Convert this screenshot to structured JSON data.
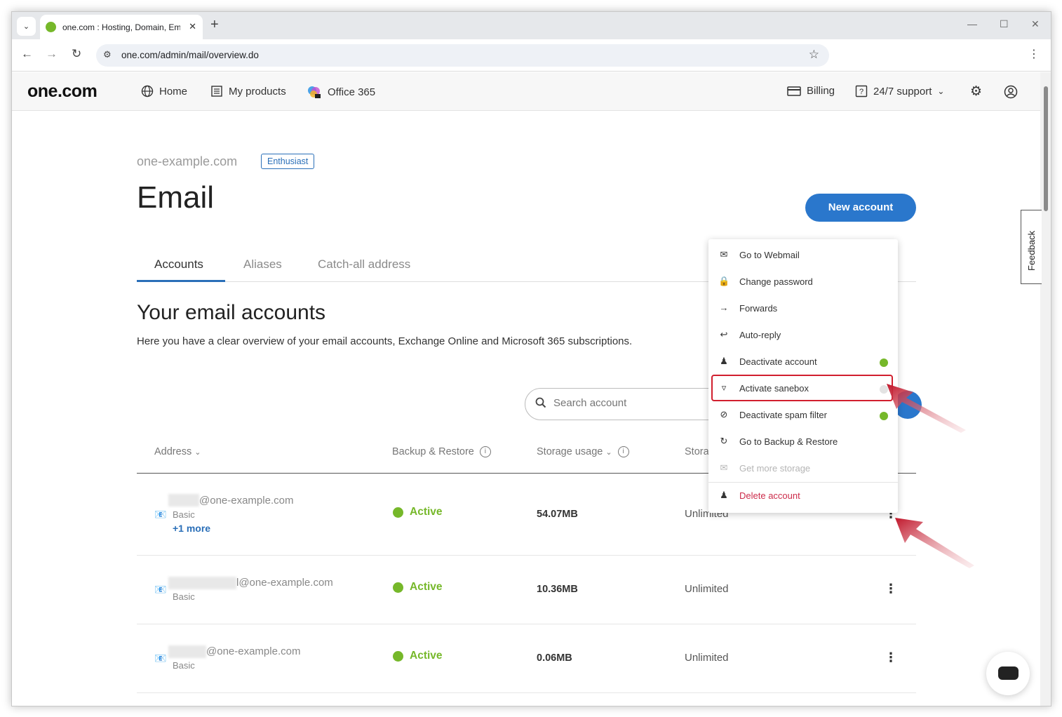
{
  "browser": {
    "tab_title": "one.com : Hosting, Domain, Em",
    "url": "one.com/admin/mail/overview.do"
  },
  "header": {
    "logo": "one.com",
    "nav": [
      {
        "label": "Home",
        "icon": "globe-icon"
      },
      {
        "label": "My products",
        "icon": "list-icon"
      },
      {
        "label": "Office 365",
        "icon": "office-icon"
      }
    ],
    "billing": "Billing",
    "support": "24/7 support"
  },
  "feedback_label": "Feedback",
  "page": {
    "domain": "one-example.com",
    "plan_badge": "Enthusiast",
    "title": "Email",
    "new_account_label": "New account",
    "tabs": [
      "Accounts",
      "Aliases",
      "Catch-all address"
    ],
    "section_title": "Your email accounts",
    "section_desc": "Here you have a clear overview of your email accounts, Exchange Online and Microsoft 365 subscriptions.",
    "search_placeholder": "Search account"
  },
  "table": {
    "columns": [
      "Address",
      "Backup & Restore",
      "Storage usage",
      "Stora"
    ],
    "rows": [
      {
        "address": "@one-example.com",
        "plan": "Basic",
        "more": "+1 more",
        "status": "Active",
        "usage": "54.07MB",
        "limit": "Unlimited"
      },
      {
        "address": "l@one-example.com",
        "plan": "Basic",
        "status": "Active",
        "usage": "10.36MB",
        "limit": "Unlimited"
      },
      {
        "address": "@one-example.com",
        "plan": "Basic",
        "status": "Active",
        "usage": "0.06MB",
        "limit": "Unlimited"
      }
    ]
  },
  "menu": {
    "items": [
      {
        "label": "Go to Webmail",
        "icon": "envelope-icon"
      },
      {
        "label": "Change password",
        "icon": "lock-icon"
      },
      {
        "label": "Forwards",
        "icon": "arrow-right-icon"
      },
      {
        "label": "Auto-reply",
        "icon": "reply-icon"
      },
      {
        "label": "Deactivate account",
        "icon": "person-icon",
        "toggle": "on"
      },
      {
        "label": "Activate sanebox",
        "icon": "filter-icon",
        "toggle": "off"
      },
      {
        "label": "Deactivate spam filter",
        "icon": "block-icon",
        "toggle": "on"
      },
      {
        "label": "Go to Backup & Restore",
        "icon": "restore-icon"
      },
      {
        "label": "Get more storage",
        "icon": "envelope-icon",
        "disabled": true
      },
      {
        "label": "Delete account",
        "icon": "person-delete-icon",
        "danger": true
      }
    ]
  },
  "colors": {
    "accent": "#2a77cc",
    "active": "#76b82a",
    "danger": "#cc2b4a",
    "highlight": "#d11f2e"
  }
}
